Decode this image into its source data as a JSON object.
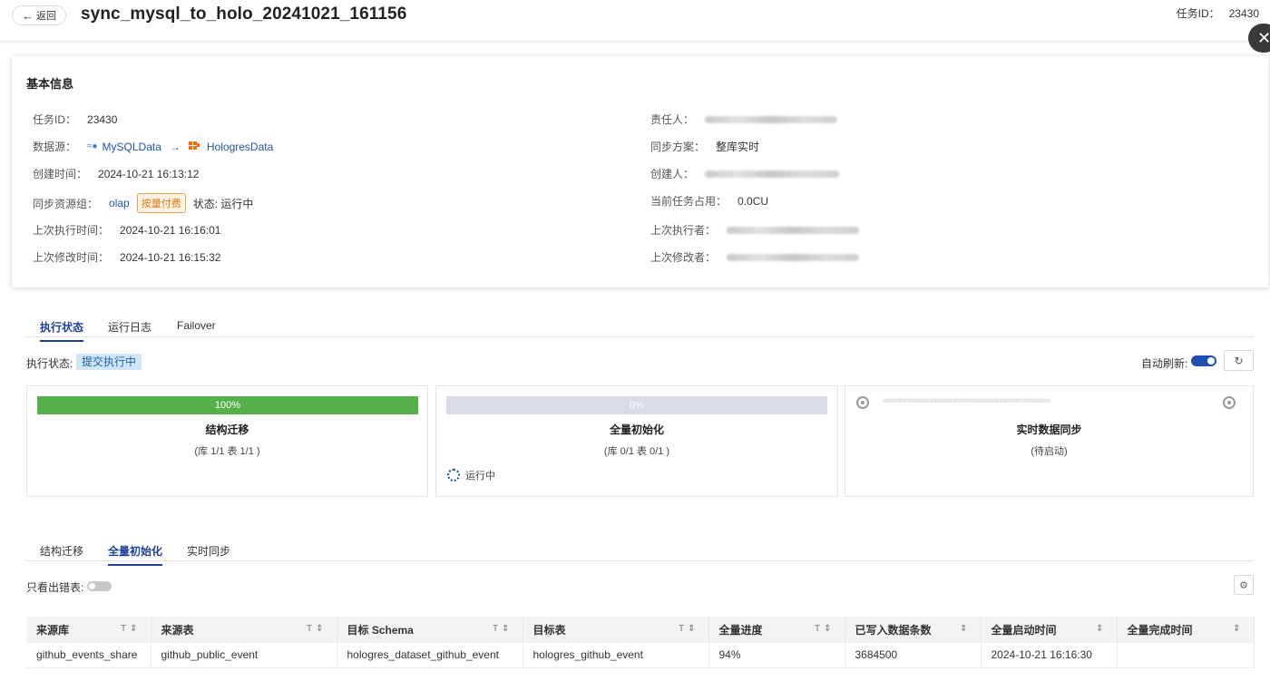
{
  "header": {
    "back_label": "返回",
    "title": "sync_mysql_to_holo_20241021_161156",
    "task_id_label": "任务ID：",
    "task_id_value": "23430"
  },
  "basic_info": {
    "title": "基本信息",
    "left": {
      "task_id_label": "任务ID：",
      "task_id_value": "23430",
      "datasource_label": "数据源：",
      "source_name": "MySQLData",
      "target_name": "HologresData",
      "created_label": "创建时间：",
      "created_value": "2024-10-21 16:13:12",
      "resource_group_label": "同步资源组：",
      "resource_group_value": "olap",
      "billing_badge": "按量付费",
      "status_text": "状态: 运行中",
      "last_exec_time_label": "上次执行时间：",
      "last_exec_time_value": "2024-10-21 16:16:01",
      "last_modify_time_label": "上次修改时间：",
      "last_modify_time_value": "2024-10-21 16:15:32"
    },
    "right": {
      "owner_label": "责任人：",
      "sync_plan_label": "同步方案：",
      "sync_plan_value": "整库实时",
      "creator_label": "创建人：",
      "current_usage_label": "当前任务占用：",
      "current_usage_value": "0.0CU",
      "last_executor_label": "上次执行者：",
      "last_modifier_label": "上次修改者："
    }
  },
  "tabs_main": [
    "执行状态",
    "运行日志",
    "Failover"
  ],
  "exec": {
    "status_label": "执行状态:",
    "status_badge": "提交执行中",
    "auto_refresh_label": "自动刷新:",
    "auto_refresh_on": true
  },
  "stages": [
    {
      "progress": 1.0,
      "progress_text": "100%",
      "name": "结构迁移",
      "detail": "(库 1/1 表 1/1 )"
    },
    {
      "progress": 0.0,
      "progress_text": "0%",
      "name": "全量初始化",
      "detail": "(库 0/1 表 0/1 )",
      "running_text": "运行中"
    },
    {
      "name": "实时数据同步",
      "detail": "(待启动)"
    }
  ],
  "tabs_sub": [
    "结构迁移",
    "全量初始化",
    "实时同步"
  ],
  "filter": {
    "only_error_label": "只看出错表:"
  },
  "table": {
    "columns": [
      "来源库",
      "来源表",
      "目标 Schema",
      "目标表",
      "全量进度",
      "已写入数据条数",
      "全量启动时间",
      "全量完成时间"
    ],
    "rows": [
      [
        "github_events_share",
        "github_public_event",
        "hologres_dataset_github_event",
        "hologres_github_event",
        "94%",
        "3684500",
        "2024-10-21 16:16:30",
        ""
      ]
    ]
  },
  "colors": {
    "accent": "#1f3f9a",
    "success": "#56b04a",
    "warning": "#e07a10"
  }
}
